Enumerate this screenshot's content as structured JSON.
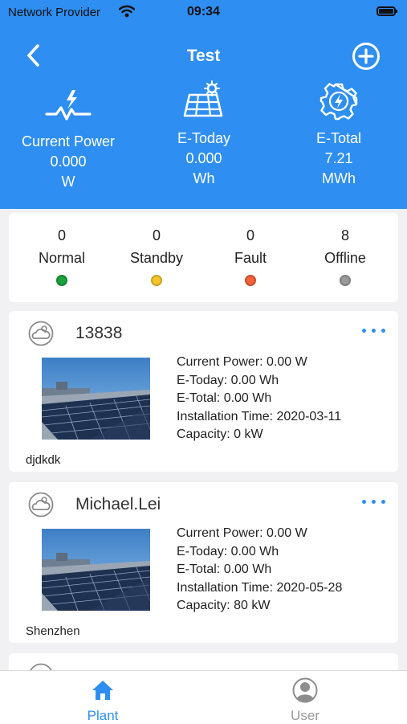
{
  "status_bar": {
    "carrier": "Network Provider",
    "time": "09:34"
  },
  "header": {
    "title": "Test",
    "stats": [
      {
        "icon": "power-pulse-icon",
        "label": "Current Power",
        "value": "0.000",
        "unit": "W"
      },
      {
        "icon": "solar-panel-icon",
        "label": "E-Today",
        "value": "0.000",
        "unit": "Wh"
      },
      {
        "icon": "gear-bolt-icon",
        "label": "E-Total",
        "value": "7.21",
        "unit": "MWh"
      }
    ]
  },
  "device_status": [
    {
      "count": "0",
      "label": "Normal",
      "color": "#1aa33a"
    },
    {
      "count": "0",
      "label": "Standby",
      "color": "#f7c52b"
    },
    {
      "count": "0",
      "label": "Fault",
      "color": "#f5623a"
    },
    {
      "count": "8",
      "label": "Offline",
      "color": "#9a9a9a"
    }
  ],
  "plants": [
    {
      "name": "13838",
      "current_power": "Current Power: 0.00 W",
      "e_today": "E-Today: 0.00 Wh",
      "e_total": "E-Total: 0.00 Wh",
      "install_time": "Installation Time: 2020-03-11",
      "capacity": "Capacity: 0 kW",
      "location": "djdkdk"
    },
    {
      "name": "Michael.Lei",
      "current_power": "Current Power: 0.00 W",
      "e_today": "E-Today: 0.00 Wh",
      "e_total": "E-Total: 0.00 Wh",
      "install_time": "Installation Time: 2020-05-28",
      "capacity": "Capacity: 80 kW",
      "location": "Shenzhen"
    }
  ],
  "tabs": [
    {
      "label": "Plant",
      "icon": "home-icon",
      "active": true,
      "color": "#2e8ef2"
    },
    {
      "label": "User",
      "icon": "user-icon",
      "active": false,
      "color": "#999999"
    }
  ],
  "colors": {
    "accent": "#2e8ef2",
    "background": "#f1f1f3"
  }
}
